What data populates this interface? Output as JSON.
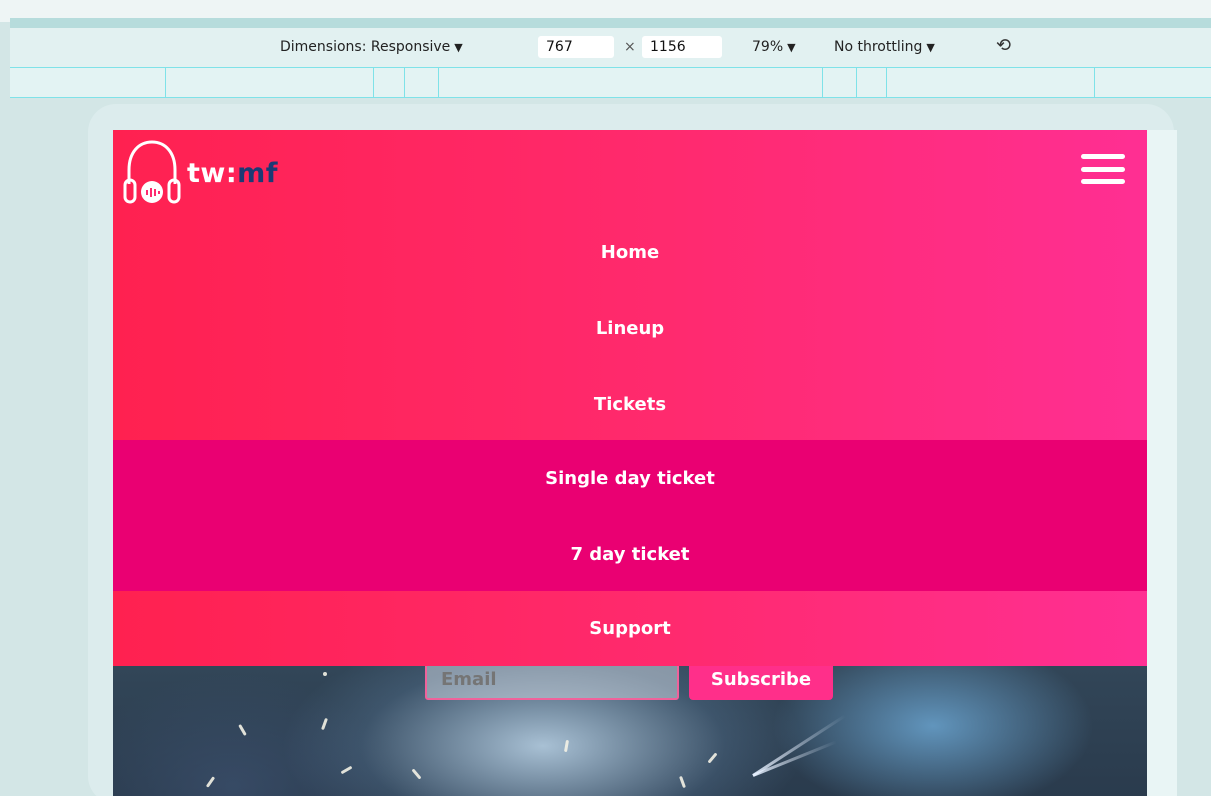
{
  "devtools": {
    "dimensions_label": "Dimensions: Responsive",
    "width_value": "767",
    "times_sign": "×",
    "height_value": "1156",
    "zoom_label": "79%",
    "throttle_label": "No throttling",
    "caret": "▼",
    "rotate_icon": "⟲"
  },
  "site": {
    "logo": {
      "text_main": "tw:",
      "text_accent": "mf"
    },
    "nav": {
      "home": "Home",
      "lineup": "Lineup",
      "tickets": "Tickets",
      "submenu": {
        "single": "Single day ticket",
        "seven": "7 day ticket"
      },
      "support": "Support"
    },
    "newsletter": {
      "email_placeholder": "Email",
      "subscribe_label": "Subscribe"
    }
  },
  "colors": {
    "nav_gradient_start": "#ff2150",
    "nav_gradient_end": "#ff2f93",
    "submenu_bg": "#ea0072",
    "logo_accent": "#1c3a74"
  }
}
